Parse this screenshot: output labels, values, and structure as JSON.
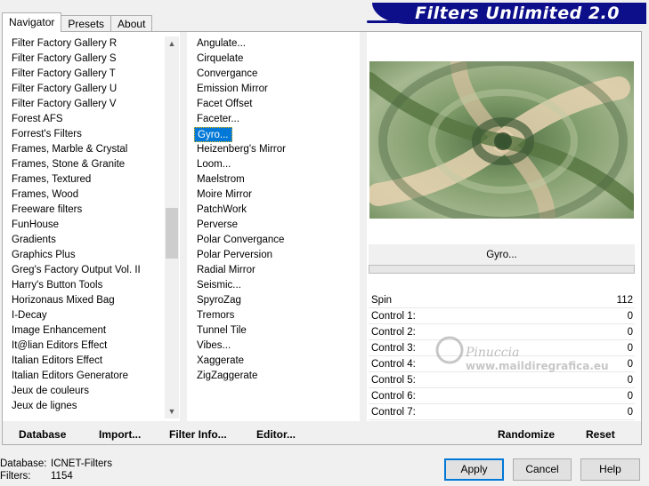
{
  "tabs": [
    "Navigator",
    "Presets",
    "About"
  ],
  "banner_title": "Filters Unlimited 2.0",
  "categories": [
    "Filter Factory Gallery R",
    "Filter Factory Gallery S",
    "Filter Factory Gallery T",
    "Filter Factory Gallery U",
    "Filter Factory Gallery V",
    "Forest AFS",
    "Forrest's Filters",
    "Frames, Marble & Crystal",
    "Frames, Stone & Granite",
    "Frames, Textured",
    "Frames, Wood",
    "Freeware filters",
    "FunHouse",
    "Gradients",
    "Graphics Plus",
    "Greg's Factory Output Vol. II",
    "Harry's Button Tools",
    "Horizonaus Mixed Bag",
    "I-Decay",
    "Image Enhancement",
    "It@lian Editors Effect",
    "Italian Editors Effect",
    "Italian Editors Generatore",
    "Jeux de couleurs",
    "Jeux de lignes"
  ],
  "selected_category": "FunHouse",
  "filters": [
    "Angulate...",
    "Cirquelate",
    "Convergance",
    "Emission Mirror",
    "Facet Offset",
    "Faceter...",
    "Gyro...",
    "Heizenberg's Mirror",
    "Loom...",
    "Maelstrom",
    "Moire Mirror",
    "PatchWork",
    "Perverse",
    "Polar Convergance",
    "Polar Perversion",
    "Radial Mirror",
    "Seismic...",
    "SpyroZag",
    "Tremors",
    "Tunnel Tile",
    "Vibes...",
    "Xaggerate",
    "ZigZaggerate"
  ],
  "selected_filter": "Gyro...",
  "current_filter_name": "Gyro...",
  "params": [
    {
      "label": "Spin",
      "value": "112"
    },
    {
      "label": "Control 1:",
      "value": "0"
    },
    {
      "label": "Control 2:",
      "value": "0"
    },
    {
      "label": "Control 3:",
      "value": "0"
    },
    {
      "label": "Control 4:",
      "value": "0"
    },
    {
      "label": "Control 5:",
      "value": "0"
    },
    {
      "label": "Control 6:",
      "value": "0"
    },
    {
      "label": "Control 7:",
      "value": "0"
    }
  ],
  "watermark": {
    "name": "Pinuccia",
    "url": "www.maildiregrafica.eu"
  },
  "bottom_links": {
    "database": "Database",
    "import": "Import...",
    "filter_info": "Filter Info...",
    "editor": "Editor...",
    "randomize": "Randomize",
    "reset": "Reset"
  },
  "db_info": {
    "database_label": "Database:",
    "database_value": "ICNET-Filters",
    "filters_label": "Filters:",
    "filters_value": "1154"
  },
  "buttons": {
    "apply": "Apply",
    "cancel": "Cancel",
    "help": "Help"
  },
  "colors": {
    "banner": "#0d0f8a",
    "selection": "#0078d7",
    "preview_green": "#7d9a68",
    "preview_cream": "#dcc8a8"
  }
}
